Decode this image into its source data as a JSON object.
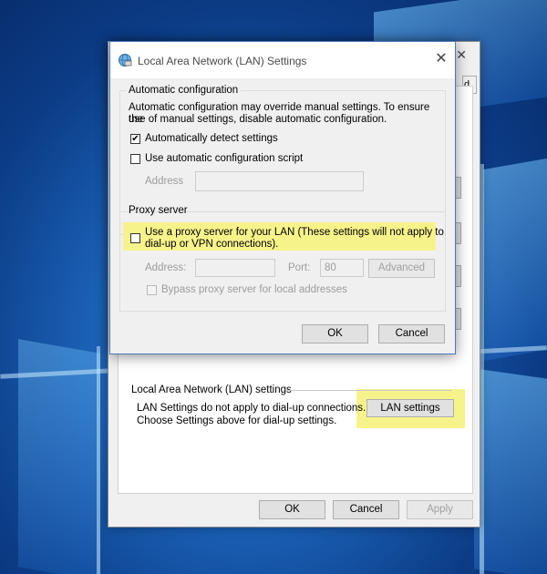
{
  "lan_dialog": {
    "title": "Local Area Network (LAN) Settings",
    "close_glyph": "✕",
    "automatic": {
      "group_label": "Automatic configuration",
      "description_line1": "Automatic configuration may override manual settings.  To ensure the",
      "description_line2": "use of manual settings, disable automatic configuration.",
      "auto_detect_label": "Automatically detect settings",
      "auto_detect_checked": true,
      "auto_script_label": "Use automatic configuration script",
      "auto_script_checked": false,
      "address_label": "Address",
      "address_value": ""
    },
    "proxy": {
      "group_label": "Proxy server",
      "use_proxy_line1": "Use a proxy server for your LAN (These settings will not apply to",
      "use_proxy_line2": "dial-up or VPN connections).",
      "use_proxy_checked": false,
      "address_label": "Address:",
      "address_value": "",
      "port_label": "Port:",
      "port_value": "80",
      "advanced_label": "Advanced",
      "bypass_label": "Bypass proxy server for local addresses",
      "bypass_checked": false
    },
    "ok_label": "OK",
    "cancel_label": "Cancel",
    "highlight_color": "#f7f38b"
  },
  "internet_properties": {
    "close_glyph": "✕",
    "tab_tail_text": "d",
    "lan_group_label": "Local Area Network (LAN) settings",
    "lan_text_line1": "LAN Settings do not apply to dial-up connections.",
    "lan_text_line2": "Choose Settings above for dial-up settings.",
    "lan_settings_label": "LAN settings",
    "ok_label": "OK",
    "cancel_label": "Cancel",
    "apply_label": "Apply"
  },
  "icons": {
    "title_icon": "globe-network-icon",
    "checkmark": "✔"
  }
}
